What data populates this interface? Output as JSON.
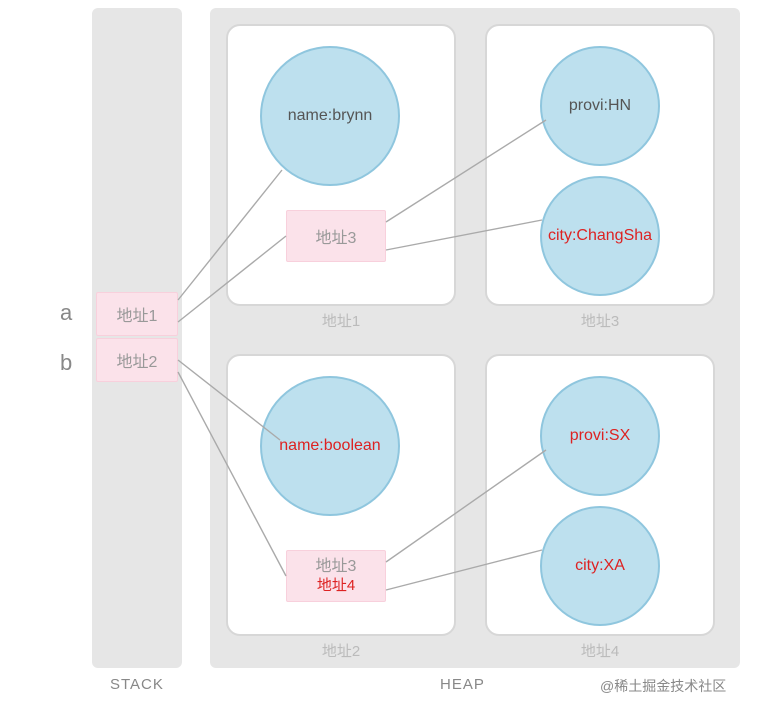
{
  "labels": {
    "stack": "STACK",
    "heap": "HEAP",
    "watermark": "@稀土掘金技术社区",
    "a": "a",
    "b": "b"
  },
  "stack_cells": {
    "addr1": "地址1",
    "addr2": "地址2"
  },
  "heap_boxes": {
    "box1_caption": "地址1",
    "box2_caption": "地址2",
    "box3_caption": "地址3",
    "box4_caption": "地址4"
  },
  "inner_addr": {
    "box1_addr": "地址3",
    "box2_addr_gray": "地址3",
    "box2_addr_red": "地址4"
  },
  "circles": {
    "name_a": "name:brynn",
    "name_b": "name:boolean",
    "provi_hn": "provi:HN",
    "city_cs": "city:ChangSha",
    "provi_sx": "provi:SX",
    "city_xa": "city:XA"
  }
}
